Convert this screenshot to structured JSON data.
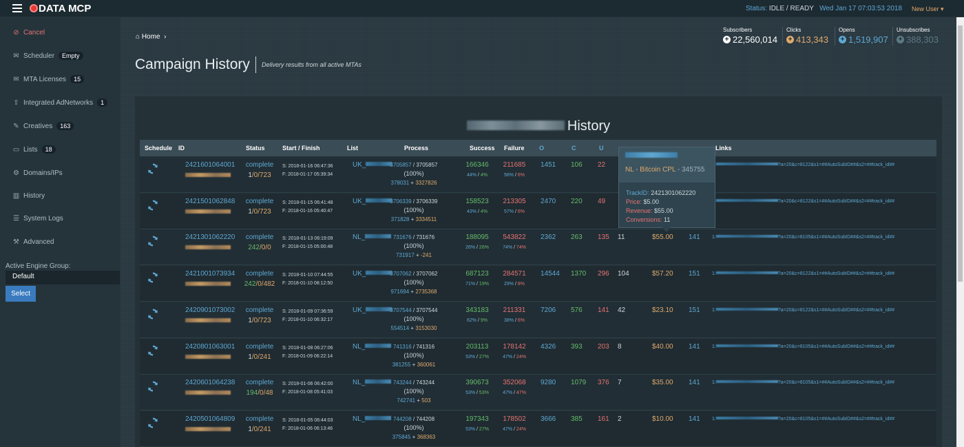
{
  "app": {
    "logo_prefix": "DATA",
    "logo_bold": "MCP"
  },
  "topbar": {
    "status_label": "Status:",
    "status_value": "IDLE / READY",
    "datetime": "Wed Jan 17 07:03:53 2018",
    "user_menu": "New User ▾"
  },
  "sidebar": {
    "items": [
      {
        "label": "Cancel",
        "icon": "ban-icon",
        "badge": ""
      },
      {
        "label": "Scheduler",
        "icon": "envelope-icon",
        "badge": "Empty"
      },
      {
        "label": "MTA Licenses",
        "icon": "envelope-icon",
        "badge": "15"
      },
      {
        "label": "Integrated AdNetworks",
        "icon": "upload-icon",
        "badge": "1"
      },
      {
        "label": "Creatives",
        "icon": "edit-icon",
        "badge": "163"
      },
      {
        "label": "Lists",
        "icon": "folder-icon",
        "badge": "18"
      },
      {
        "label": "Domains/IPs",
        "icon": "cogs-icon",
        "badge": ""
      },
      {
        "label": "History",
        "icon": "bar-chart-icon",
        "badge": ""
      },
      {
        "label": "System Logs",
        "icon": "list-icon",
        "badge": ""
      },
      {
        "label": "Advanced",
        "icon": "wrench-icon",
        "badge": ""
      }
    ],
    "engine_group_label": "Active Engine Group:",
    "engine_group_value": "Default",
    "select_button": "Select"
  },
  "header": {
    "breadcrumb_home": "Home",
    "title": "Campaign History",
    "subtitle": "Delivery results from all active MTAs"
  },
  "stats": [
    {
      "label": "Subscribers",
      "value": "22,560,014",
      "color": "#ffffff"
    },
    {
      "label": "Clicks",
      "value": "413,343",
      "color": "#e0a96d"
    },
    {
      "label": "Opens",
      "value": "1,519,907",
      "color": "#5fa8d3"
    },
    {
      "label": "Unsubscribes",
      "value": "388,303",
      "color": "#5f7a85"
    }
  ],
  "panel": {
    "title_suffix": "History"
  },
  "table": {
    "headers": {
      "schedule": "Schedule",
      "id": "ID",
      "status": "Status",
      "start_finish": "Start / Finish",
      "list": "List",
      "process": "Process",
      "success": "Success",
      "failure": "Failure",
      "o": "O",
      "c": "C",
      "u": "U",
      "links": "Links"
    },
    "rows": [
      {
        "id": "2421601064001",
        "status": "complete",
        "s1": "1",
        "s2": "0",
        "s3": "723",
        "start": "S: 2018-01-16 06:47:36",
        "finish": "F: 2018-01-17 05:39:34",
        "list": "UK_",
        "proc_a": "3705857",
        "proc_b": "3705857",
        "proc_pct": "(100%)",
        "proc_c": "378031",
        "proc_d": "3327826",
        "success": "166346",
        "succ_p1": "44%",
        "succ_p2": "4%",
        "failure": "211685",
        "fail_p1": "56%",
        "fail_p2": "6%",
        "o": "1451",
        "c": "106",
        "u": "22",
        "n": "",
        "rev": "",
        "k": "",
        "link_prefix": "1:",
        "link_suffix": "?a=20&c=8122&s1=##AutoSubID##&s2=##track_id##"
      },
      {
        "id": "2421501062848",
        "status": "complete",
        "s1": "1",
        "s2": "0",
        "s3": "723",
        "start": "S: 2018-01-15 06:41:48",
        "finish": "F: 2018-01-16 05:40:47",
        "list": "UK_",
        "proc_a": "3706339",
        "proc_b": "3706339",
        "proc_pct": "(100%)",
        "proc_c": "371828",
        "proc_d": "3334511",
        "success": "158523",
        "succ_p1": "43%",
        "succ_p2": "4%",
        "failure": "213305",
        "fail_p1": "57%",
        "fail_p2": "6%",
        "o": "2470",
        "c": "220",
        "u": "49",
        "n": "",
        "rev": "",
        "k": "",
        "link_prefix": "1:",
        "link_suffix": "?a=20&c=8122&s1=##AutoSubID##&s2=##track_id##"
      },
      {
        "id": "2421301062220",
        "status": "complete",
        "s1": "242",
        "s2": "0",
        "s3": "0",
        "start": "S: 2018-01-13 06:19:09",
        "finish": "F: 2018-01-15 05:00:48",
        "list": "NL_",
        "proc_a": "731676",
        "proc_b": "731676",
        "proc_pct": "(100%)",
        "proc_c": "731917",
        "proc_d": "-241",
        "success": "188095",
        "succ_p1": "26%",
        "succ_p2": "26%",
        "failure": "543822",
        "fail_p1": "74%",
        "fail_p2": "74%",
        "o": "2362",
        "c": "263",
        "u": "135",
        "n": "11",
        "rev": "$55.00",
        "k": "141",
        "link_prefix": "1:",
        "link_suffix": "?a=20&c=8105&s1=##AutoSubID##&s2=##track_id##"
      },
      {
        "id": "2421001073934",
        "status": "complete",
        "s1": "242",
        "s2": "0",
        "s3": "482",
        "start": "S: 2018-01-10 07:44:55",
        "finish": "F: 2018-01-10 08:12:50",
        "list": "UK_",
        "proc_a": "3707062",
        "proc_b": "3707062",
        "proc_pct": "(100%)",
        "proc_c": "971694",
        "proc_d": "2735368",
        "success": "687123",
        "succ_p1": "71%",
        "succ_p2": "19%",
        "failure": "284571",
        "fail_p1": "29%",
        "fail_p2": "8%",
        "o": "14544",
        "c": "1370",
        "u": "296",
        "n": "104",
        "rev": "$57.20",
        "k": "151",
        "link_prefix": "1:",
        "link_suffix": "?a=20&c=8122&s1=##AutoSubID##&s2=##track_id##"
      },
      {
        "id": "2420901073002",
        "status": "complete",
        "s1": "1",
        "s2": "0",
        "s3": "723",
        "start": "S: 2018-01-09 07:36:59",
        "finish": "F: 2018-01-10 06:32:17",
        "list": "UK_",
        "proc_a": "3707544",
        "proc_b": "3707544",
        "proc_pct": "(100%)",
        "proc_c": "554514",
        "proc_d": "3153030",
        "success": "343183",
        "succ_p1": "62%",
        "succ_p2": "9%",
        "failure": "211331",
        "fail_p1": "38%",
        "fail_p2": "6%",
        "o": "7206",
        "c": "576",
        "u": "141",
        "n": "42",
        "rev": "$23.10",
        "k": "151",
        "link_prefix": "1:",
        "link_suffix": "?a=20&c=8122&s1=##AutoSubID##&s2=##track_id##"
      },
      {
        "id": "2420801063001",
        "status": "complete",
        "s1": "1",
        "s2": "0",
        "s3": "241",
        "start": "S: 2018-01-08 06:27:06",
        "finish": "F: 2018-01-09 06:22:14",
        "list": "NL_",
        "proc_a": "741316",
        "proc_b": "741316",
        "proc_pct": "(100%)",
        "proc_c": "381255",
        "proc_d": "360061",
        "success": "203113",
        "succ_p1": "53%",
        "succ_p2": "27%",
        "failure": "178142",
        "fail_p1": "47%",
        "fail_p2": "24%",
        "o": "4326",
        "c": "393",
        "u": "203",
        "n": "8",
        "rev": "$40.00",
        "k": "141",
        "link_prefix": "1:",
        "link_suffix": "?a=20&c=8105&s1=##AutoSubID##&s2=##track_id##"
      },
      {
        "id": "2420601064238",
        "status": "complete",
        "s1": "194",
        "s2": "0",
        "s3": "48",
        "start": "S: 2018-01-06 06:42:00",
        "finish": "F: 2018-01-08 05:41:03",
        "list": "NL_",
        "proc_a": "743244",
        "proc_b": "743244",
        "proc_pct": "(100%)",
        "proc_c": "742741",
        "proc_d": "503",
        "success": "390673",
        "succ_p1": "53%",
        "succ_p2": "53%",
        "failure": "352068",
        "fail_p1": "47%",
        "fail_p2": "47%",
        "o": "9280",
        "c": "1079",
        "u": "376",
        "n": "7",
        "rev": "$35.00",
        "k": "141",
        "link_prefix": "1:",
        "link_suffix": "?a=20&c=8105&s1=##AutoSubID##&s2=##track_id##"
      },
      {
        "id": "2420501064809",
        "status": "complete",
        "s1": "1",
        "s2": "0",
        "s3": "241",
        "start": "S: 2018-01-05 06:44:03",
        "finish": "F: 2018-01-06 06:13:46",
        "list": "NL_",
        "proc_a": "744208",
        "proc_b": "744208",
        "proc_pct": "(100%)",
        "proc_c": "375845",
        "proc_d": "368363",
        "success": "197343",
        "succ_p1": "53%",
        "succ_p2": "27%",
        "failure": "178502",
        "fail_p1": "47%",
        "fail_p2": "24%",
        "o": "3666",
        "c": "385",
        "u": "161",
        "n": "2",
        "rev": "$10.00",
        "k": "141",
        "link_prefix": "1:",
        "link_suffix": "?a=20&c=8105&s1=##AutoSubID##&s2=##track_id##"
      }
    ]
  },
  "tooltip": {
    "name": "NL - Bitcoin CPL",
    "number": "345755",
    "trackid_label": "TrackID:",
    "trackid": "2421301062220",
    "price_label": "Price:",
    "price": "$5.00",
    "revenue_label": "Revenue:",
    "revenue": "$55.00",
    "conversions_label": "Conversions:",
    "conversions": "11"
  }
}
